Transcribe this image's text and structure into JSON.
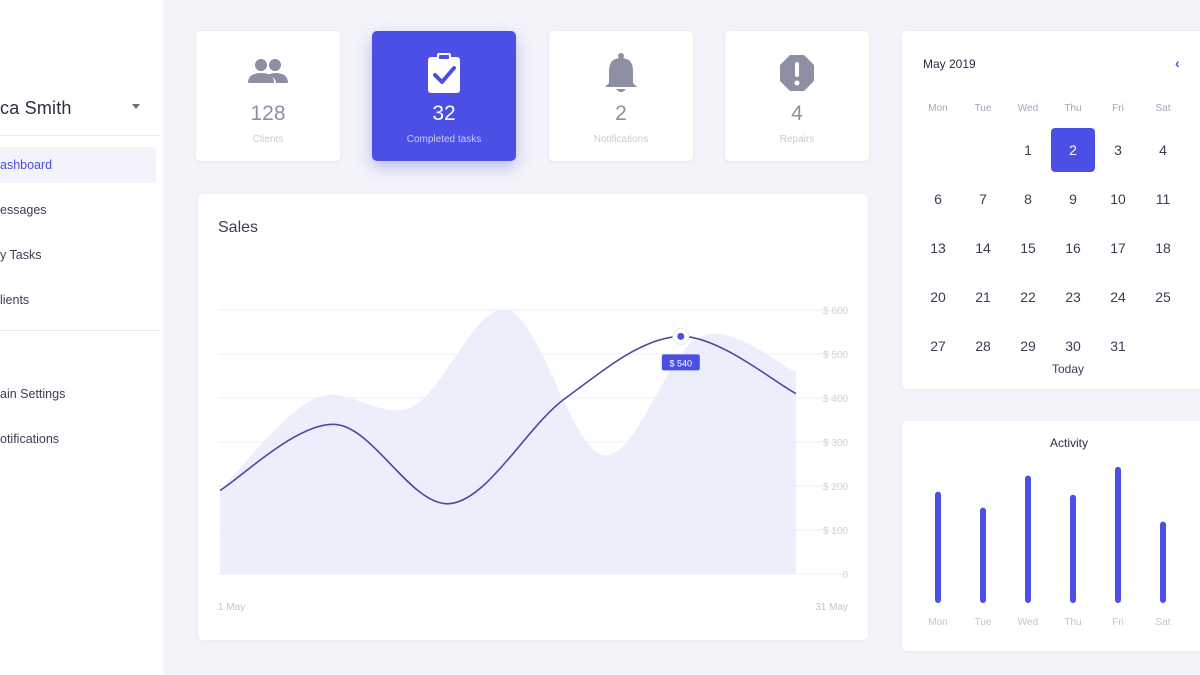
{
  "sidebar": {
    "user_name": "ca Smith",
    "items": [
      {
        "label": "ashboard",
        "active": true
      },
      {
        "label": "essages"
      },
      {
        "label": "y Tasks"
      },
      {
        "label": "lients"
      },
      {
        "label": "ain Settings"
      },
      {
        "label": "otifications"
      }
    ]
  },
  "stats": [
    {
      "icon": "clients-icon",
      "value": "128",
      "label": "Clients"
    },
    {
      "icon": "clipboard-check-icon",
      "value": "32",
      "label": "Completed tasks"
    },
    {
      "icon": "bell-icon",
      "value": "2",
      "label": "Notifications"
    },
    {
      "icon": "alert-icon",
      "value": "4",
      "label": "Repairs"
    }
  ],
  "sales": {
    "title": "Sales",
    "tooltip": "$ 540",
    "chart_data": {
      "type": "line",
      "x_start": "1 May",
      "x_end": "31 May",
      "y_ticks": [
        "$ 600",
        "$ 500",
        "$ 400",
        "$ 300",
        "$ 200",
        "$ 100",
        "0"
      ],
      "ylim": [
        0,
        600
      ],
      "series": [
        {
          "values": [
            190,
            340,
            160,
            400,
            540,
            410
          ]
        },
        {
          "values": [
            190,
            400,
            380,
            600,
            270,
            540,
            460
          ]
        }
      ],
      "highlight": {
        "value": 540
      }
    }
  },
  "calendar": {
    "month": "May 2019",
    "days_of_week": [
      "Mon",
      "Tue",
      "Wed",
      "Thu",
      "Fri",
      "Sat"
    ],
    "weeks": [
      [
        "",
        "",
        "1",
        "2",
        "3",
        "4"
      ],
      [
        "6",
        "7",
        "8",
        "9",
        "10",
        "11"
      ],
      [
        "13",
        "14",
        "15",
        "16",
        "17",
        "18"
      ],
      [
        "20",
        "21",
        "22",
        "23",
        "24",
        "25"
      ],
      [
        "27",
        "28",
        "29",
        "30",
        "31",
        ""
      ]
    ],
    "selected": "2",
    "today_label": "Today"
  },
  "activity": {
    "title": "Activity",
    "chart_data": {
      "type": "bar",
      "categories": [
        "Mon",
        "Tue",
        "Wed",
        "Thu",
        "Fri",
        "Sat"
      ],
      "values": [
        104,
        89,
        119,
        101,
        127,
        76
      ],
      "ylim": [
        0,
        140
      ]
    }
  },
  "colors": {
    "accent": "#4c4fe6",
    "area": "#eceefb",
    "line": "#4a4a9e"
  }
}
